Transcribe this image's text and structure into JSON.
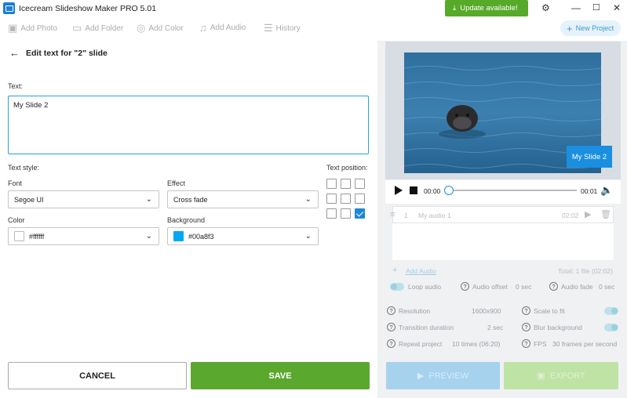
{
  "app": {
    "title": "Icecream Slideshow Maker PRO 5.01",
    "update_label": "Update available!"
  },
  "toolbar": {
    "add_photo": "Add Photo",
    "add_folder": "Add Folder",
    "add_color": "Add Color",
    "add_audio": "Add Audio",
    "history": "History",
    "new_project": "New Project"
  },
  "editor": {
    "header": "Edit text for \"2\" slide",
    "text_label": "Text:",
    "text_value": "My Slide 2",
    "text_style_label": "Text style:",
    "font_label": "Font",
    "font_value": "Segoe UI",
    "effect_label": "Effect",
    "effect_value": "Cross fade",
    "color_label": "Color",
    "color_value": "#ffffff",
    "background_label": "Background",
    "background_value": "#00a8f3",
    "text_position_label": "Text position:",
    "text_position_selected": "bottom-right",
    "cancel_label": "CANCEL",
    "save_label": "SAVE"
  },
  "preview": {
    "slide_text": "My Slide 2",
    "time_current": "00:00",
    "time_total": "00:01",
    "progress": 0
  },
  "audio": {
    "row_index": "1",
    "row_name": "My audio 1",
    "row_duration": "02:02",
    "add_audio": "Add Audio",
    "total": "Total: 1 file (02:02)",
    "loop_audio": "Loop audio",
    "audio_offset_label": "Audio offset",
    "audio_offset_value": "0 sec",
    "audio_fade_label": "Audio fade",
    "audio_fade_value": "0 sec"
  },
  "settings": {
    "resolution_label": "Resolution",
    "resolution_value": "1600x900",
    "scale_label": "Scale to fit",
    "transition_label": "Transition duration",
    "transition_value": "2 sec",
    "blur_label": "Blur background",
    "repeat_label": "Repeat project",
    "repeat_value": "10 times (06:20)",
    "fps_label": "FPS",
    "fps_value": "30 frames per second"
  },
  "actions": {
    "preview_label": "PREVIEW",
    "export_label": "EXPORT"
  },
  "colors": {
    "accent": "#1a8fe0",
    "save_green": "#5ba82e",
    "update_green": "#57a92a",
    "bg_swatch": "#00a8f3"
  },
  "icons": [
    "app-icon",
    "download-icon",
    "gear-icon",
    "minimize-icon",
    "maximize-icon",
    "close-icon",
    "back-arrow-icon",
    "play-icon",
    "stop-icon",
    "volume-icon",
    "drag-handle-icon",
    "trash-icon",
    "plus-icon",
    "help-icon"
  ]
}
